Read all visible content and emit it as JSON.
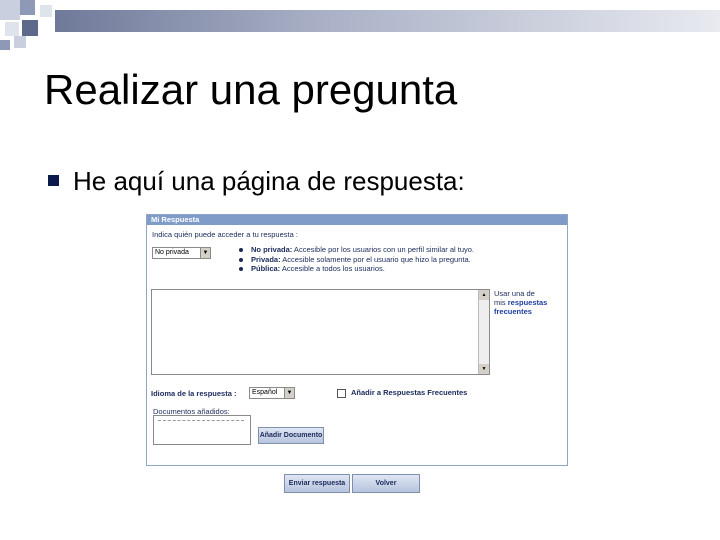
{
  "slide": {
    "title": "Realizar una pregunta",
    "bullet": "He aquí una página de respuesta:"
  },
  "panel": {
    "header": "Mi Respuesta",
    "access_prompt": "Indica quién puede acceder a tu respuesta :",
    "access_select": "No privada",
    "options": [
      {
        "name": "No privada:",
        "desc": " Accesible por los usuarios con un perfil similar al tuyo."
      },
      {
        "name": "Privada:",
        "desc": " Accesible solamente por el usuario que hizo la pregunta."
      },
      {
        "name": "Pública:",
        "desc": " Accesible a todos los usuarios."
      }
    ],
    "side_note": {
      "line1": "Usar una de",
      "line2_prefix": "mis ",
      "line2_link": "respuestas",
      "line3_link": "frecuentes"
    },
    "language_label": "Idioma de la respuesta :",
    "language_select": "Español",
    "add_frequent_label": "Añadir a Respuestas Frecuentes",
    "documents_label": "Documentos añadidos:",
    "add_document_button": "Añadir Documento"
  },
  "buttons": {
    "send": "Enviar respuesta",
    "back": "Volver"
  },
  "colors": {
    "bullet": "#0a1a4a",
    "panel_header": "#7f9bc8",
    "link": "#1f3f9f"
  }
}
